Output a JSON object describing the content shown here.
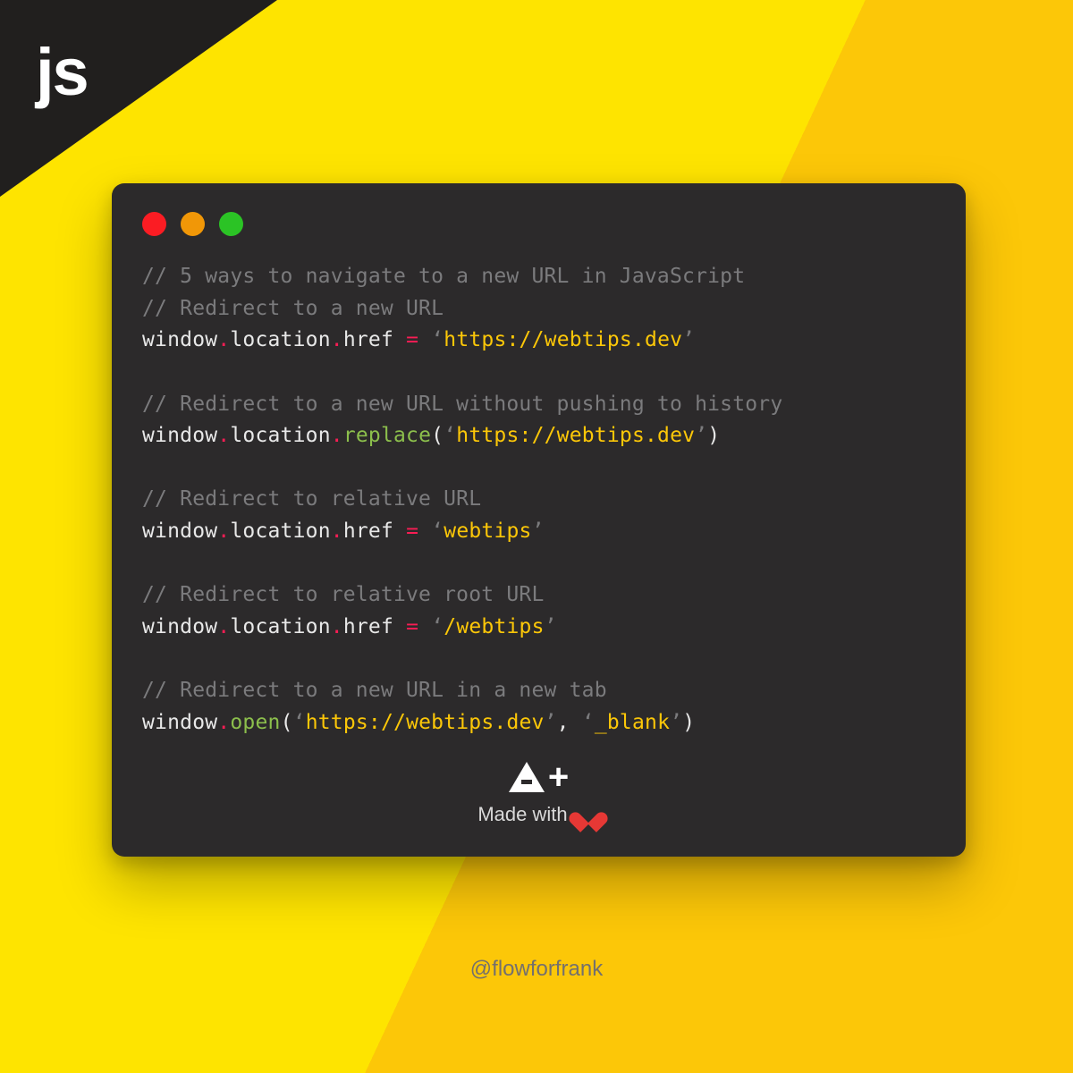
{
  "badge": "js",
  "window": {
    "dots": [
      "red",
      "yellow",
      "green"
    ]
  },
  "code": {
    "blocks": [
      {
        "comment_lines": [
          "// 5 ways to navigate to a new URL in JavaScript",
          "// Redirect to a new URL"
        ],
        "line": {
          "kind": "assign",
          "chain": [
            "window",
            "location",
            "href"
          ],
          "string": "https://webtips.dev"
        }
      },
      {
        "comment_lines": [
          "// Redirect to a new URL without pushing to history"
        ],
        "line": {
          "kind": "call",
          "chain": [
            "window",
            "location"
          ],
          "func": "replace",
          "args": [
            {
              "type": "string",
              "value": "https://webtips.dev"
            }
          ]
        }
      },
      {
        "comment_lines": [
          "// Redirect to relative URL"
        ],
        "line": {
          "kind": "assign",
          "chain": [
            "window",
            "location",
            "href"
          ],
          "string": "webtips"
        }
      },
      {
        "comment_lines": [
          "// Redirect to relative root URL"
        ],
        "line": {
          "kind": "assign",
          "chain": [
            "window",
            "location",
            "href"
          ],
          "string": "/webtips"
        }
      },
      {
        "comment_lines": [
          "// Redirect to a new URL in a new tab"
        ],
        "line": {
          "kind": "call",
          "chain": [
            "window"
          ],
          "func": "open",
          "args": [
            {
              "type": "string",
              "value": "https://webtips.dev"
            },
            {
              "type": "string",
              "value": "_blank"
            }
          ]
        }
      }
    ]
  },
  "footer": {
    "aplus_text": "+",
    "made_with": "Made with"
  },
  "handle": "@flowforfrank",
  "colors": {
    "bg_primary": "#fee400",
    "bg_secondary": "#fcc708",
    "window": "#2c2a2b",
    "comment": "#7b7b7d",
    "accent_pink": "#f91d54",
    "string": "#fcc708",
    "func": "#8cbf4c",
    "heart": "#e63835"
  }
}
